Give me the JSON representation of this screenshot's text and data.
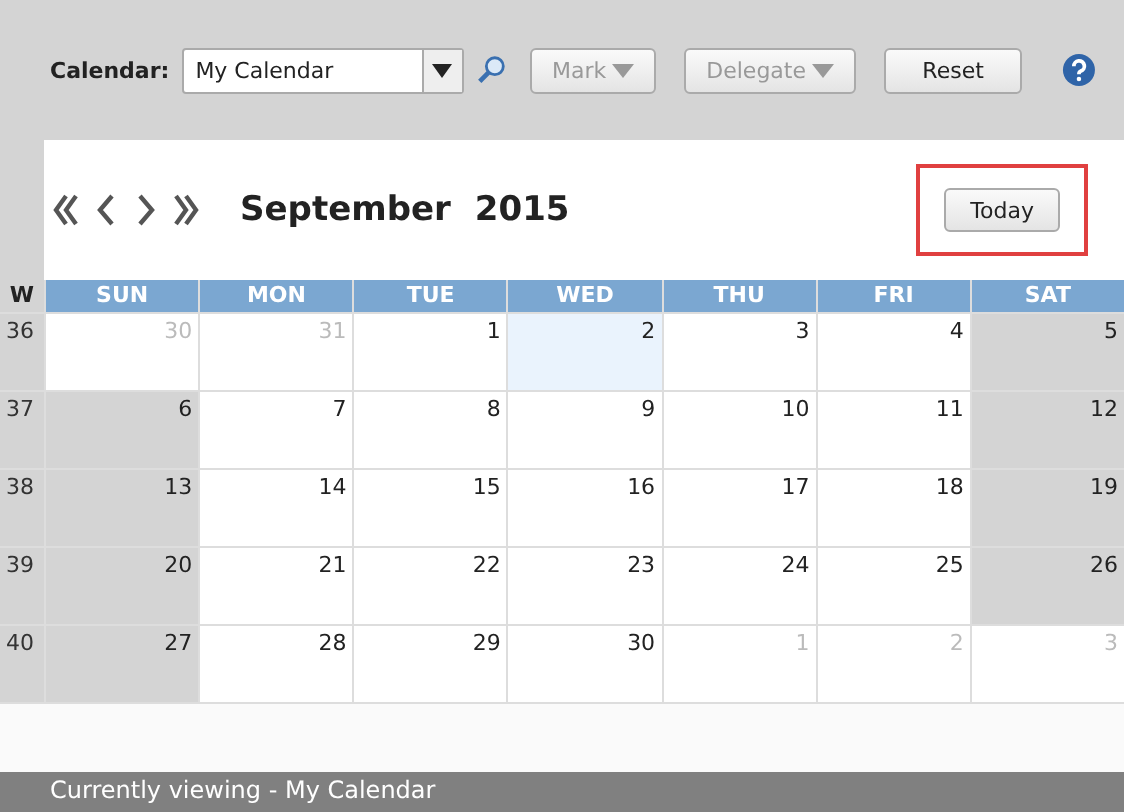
{
  "toolbar": {
    "calendar_label": "Calendar:",
    "calendar_value": "My Calendar",
    "buttons": [
      {
        "label": "Mark",
        "disabled": true,
        "dropdown": true
      },
      {
        "label": "Delegate",
        "disabled": true,
        "dropdown": true
      },
      {
        "label": "Reset",
        "disabled": false,
        "dropdown": false
      }
    ]
  },
  "header": {
    "month": "September",
    "year": "2015",
    "today_button": {
      "label": "Today",
      "highlighted": true
    }
  },
  "grid": {
    "week_heading": "W",
    "days": [
      "SUN",
      "MON",
      "TUE",
      "WED",
      "THU",
      "FRI",
      "SAT"
    ],
    "weeks": [
      {
        "week": "36",
        "cells": [
          {
            "day": "30",
            "outside": true,
            "weekend": false,
            "today": false
          },
          {
            "day": "31",
            "outside": true,
            "weekend": false,
            "today": false
          },
          {
            "day": "1",
            "outside": false,
            "weekend": false,
            "today": false
          },
          {
            "day": "2",
            "outside": false,
            "weekend": false,
            "today": true
          },
          {
            "day": "3",
            "outside": false,
            "weekend": false,
            "today": false
          },
          {
            "day": "4",
            "outside": false,
            "weekend": false,
            "today": false
          },
          {
            "day": "5",
            "outside": false,
            "weekend": true,
            "today": false
          }
        ]
      },
      {
        "week": "37",
        "cells": [
          {
            "day": "6",
            "outside": false,
            "weekend": true,
            "today": false
          },
          {
            "day": "7",
            "outside": false,
            "weekend": false,
            "today": false
          },
          {
            "day": "8",
            "outside": false,
            "weekend": false,
            "today": false
          },
          {
            "day": "9",
            "outside": false,
            "weekend": false,
            "today": false
          },
          {
            "day": "10",
            "outside": false,
            "weekend": false,
            "today": false
          },
          {
            "day": "11",
            "outside": false,
            "weekend": false,
            "today": false
          },
          {
            "day": "12",
            "outside": false,
            "weekend": true,
            "today": false
          }
        ]
      },
      {
        "week": "38",
        "cells": [
          {
            "day": "13",
            "outside": false,
            "weekend": true,
            "today": false
          },
          {
            "day": "14",
            "outside": false,
            "weekend": false,
            "today": false
          },
          {
            "day": "15",
            "outside": false,
            "weekend": false,
            "today": false
          },
          {
            "day": "16",
            "outside": false,
            "weekend": false,
            "today": false
          },
          {
            "day": "17",
            "outside": false,
            "weekend": false,
            "today": false
          },
          {
            "day": "18",
            "outside": false,
            "weekend": false,
            "today": false
          },
          {
            "day": "19",
            "outside": false,
            "weekend": true,
            "today": false
          }
        ]
      },
      {
        "week": "39",
        "cells": [
          {
            "day": "20",
            "outside": false,
            "weekend": true,
            "today": false
          },
          {
            "day": "21",
            "outside": false,
            "weekend": false,
            "today": false
          },
          {
            "day": "22",
            "outside": false,
            "weekend": false,
            "today": false
          },
          {
            "day": "23",
            "outside": false,
            "weekend": false,
            "today": false
          },
          {
            "day": "24",
            "outside": false,
            "weekend": false,
            "today": false
          },
          {
            "day": "25",
            "outside": false,
            "weekend": false,
            "today": false
          },
          {
            "day": "26",
            "outside": false,
            "weekend": true,
            "today": false
          }
        ]
      },
      {
        "week": "40",
        "cells": [
          {
            "day": "27",
            "outside": false,
            "weekend": true,
            "today": false
          },
          {
            "day": "28",
            "outside": false,
            "weekend": false,
            "today": false
          },
          {
            "day": "29",
            "outside": false,
            "weekend": false,
            "today": false
          },
          {
            "day": "30",
            "outside": false,
            "weekend": false,
            "today": false
          },
          {
            "day": "1",
            "outside": true,
            "weekend": false,
            "today": false
          },
          {
            "day": "2",
            "outside": true,
            "weekend": false,
            "today": false
          },
          {
            "day": "3",
            "outside": true,
            "weekend": false,
            "today": false
          }
        ]
      }
    ]
  },
  "status_bar": "Currently viewing - My Calendar"
}
